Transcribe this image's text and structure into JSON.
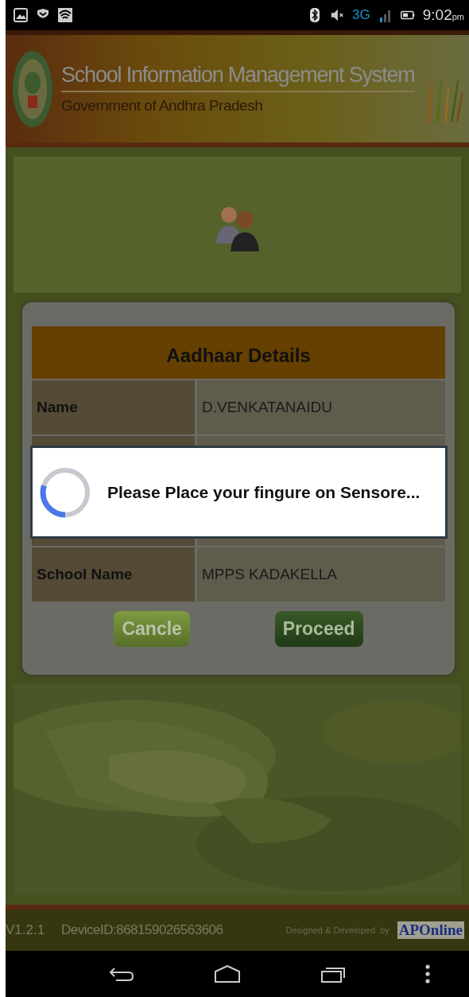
{
  "status_bar": {
    "network": "3G",
    "time": "9:02",
    "time_suffix": "pm"
  },
  "header": {
    "title": "School Information Management System",
    "subtitle": "Government of Andhra Pradesh"
  },
  "card": {
    "title": "Aadhaar Details",
    "rows": [
      {
        "kind": "field",
        "label": "Name",
        "value": "D.VENKATANAIDU"
      },
      {
        "kind": "covered"
      },
      {
        "kind": "covered"
      },
      {
        "kind": "field",
        "label": "School Name",
        "value": "MPPS KADAKELLA"
      }
    ],
    "buttons": [
      {
        "label": "Cancle",
        "kind": "secondary"
      },
      {
        "label": "Proceed",
        "kind": "primary"
      }
    ]
  },
  "dialog": {
    "message": "Please Place your fingure on Sensore..."
  },
  "footer": {
    "version": "V1.2.1",
    "device_id": "DeviceID:868159026563606",
    "credit": "Designed & Developed  by",
    "brand": "APOnline"
  }
}
